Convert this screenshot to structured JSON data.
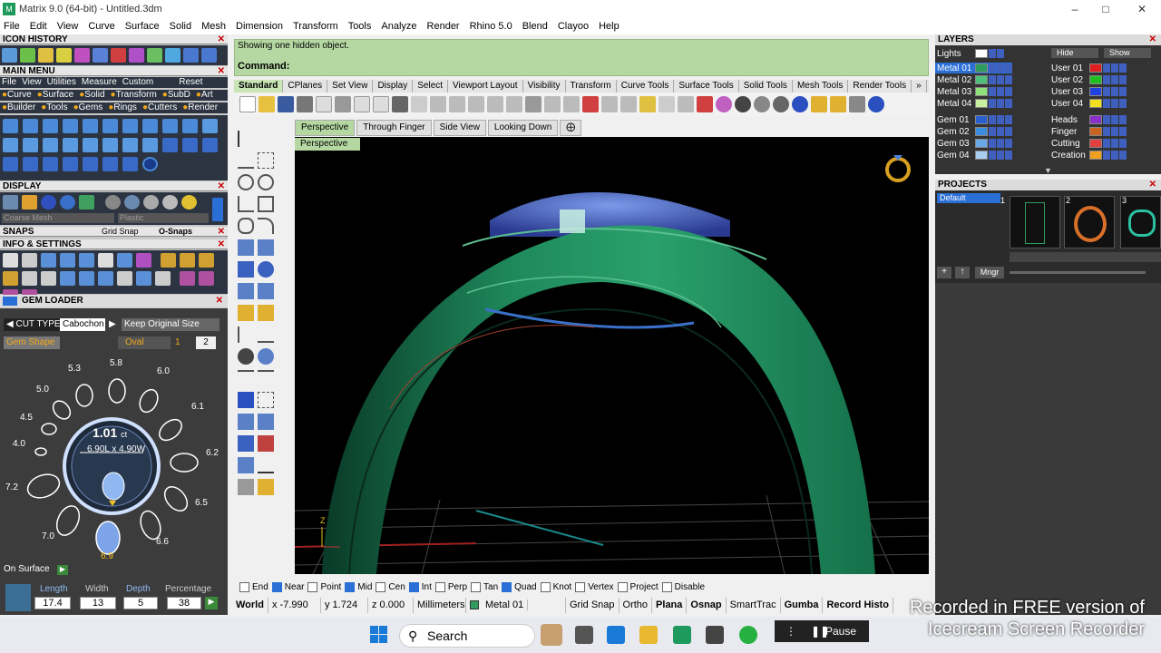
{
  "window": {
    "title": "Matrix 9.0 (64-bit) - Untitled.3dm"
  },
  "menu": [
    "File",
    "Edit",
    "View",
    "Curve",
    "Surface",
    "Solid",
    "Mesh",
    "Dimension",
    "Transform",
    "Tools",
    "Analyze",
    "Render",
    "Rhino 5.0",
    "Blend",
    "Clayoo",
    "Help"
  ],
  "left": {
    "icon_history": "ICON HISTORY",
    "main_menu": "MAIN MENU",
    "main_menu_row1": [
      "File",
      "View",
      "Utilities",
      "Measure",
      "Custom"
    ],
    "main_menu_reset": "Reset",
    "main_menu_row2": [
      "Curve",
      "Surface",
      "Solid",
      "Transform",
      "SubD",
      "Art"
    ],
    "main_menu_row3": [
      "Builder",
      "Tools",
      "Gems",
      "Rings",
      "Cutters",
      "Render"
    ],
    "display": "DISPLAY",
    "display_mesh": "Coarse Mesh",
    "display_material": "Plastic",
    "snaps": "SNAPS",
    "grid_snap": "Grid Snap",
    "osnaps": "O-Snaps",
    "info_settings": "INFO & SETTINGS",
    "gem_loader": "GEM LOADER",
    "cut_type_label": "CUT TYPE",
    "cut_type_value": "Cabochon",
    "keep_original": "Keep Original Size",
    "gem_shape_label": "Gem Shape",
    "gem_shape_value": "Oval",
    "gem_opt1": "1",
    "gem_opt2": "2",
    "sizes": [
      "5.8",
      "6.0",
      "6.1",
      "6.2",
      "6.5",
      "6.6",
      "6.9",
      "7.0",
      "7.2",
      "4.0",
      "4.5",
      "5.0",
      "5.3"
    ],
    "carat": "1.01",
    "carat_unit": "ct",
    "dims": "6.90L x 4.90W",
    "on_surface": "On Surface",
    "length_label": "Length",
    "width_label": "Width",
    "depth_label": "Depth",
    "percentage_label": "Percentage",
    "length": "17.4",
    "width": "13",
    "depth": "5",
    "percentage": "38"
  },
  "command": {
    "message": "Showing one hidden object.",
    "label": "Command:"
  },
  "tabs": [
    "Standard",
    "CPlanes",
    "Set View",
    "Display",
    "Select",
    "Viewport Layout",
    "Visibility",
    "Transform",
    "Curve Tools",
    "Surface Tools",
    "Solid Tools",
    "Mesh Tools",
    "Render Tools"
  ],
  "viewport_tabs": [
    "Perspective",
    "Through Finger",
    "Side View",
    "Looking Down"
  ],
  "viewport_name": "Perspective",
  "osnaps": [
    {
      "label": "End",
      "on": false
    },
    {
      "label": "Near",
      "on": true
    },
    {
      "label": "Point",
      "on": false
    },
    {
      "label": "Mid",
      "on": true
    },
    {
      "label": "Cen",
      "on": false
    },
    {
      "label": "Int",
      "on": true
    },
    {
      "label": "Perp",
      "on": false
    },
    {
      "label": "Tan",
      "on": false
    },
    {
      "label": "Quad",
      "on": true
    },
    {
      "label": "Knot",
      "on": false
    },
    {
      "label": "Vertex",
      "on": false
    },
    {
      "label": "Project",
      "on": false
    },
    {
      "label": "Disable",
      "on": false
    }
  ],
  "status": {
    "cplane": "World",
    "x": "x -7.990",
    "y": "y 1.724",
    "z": "z 0.000",
    "units": "Millimeters",
    "layer": "Metal 01",
    "items": [
      "Grid Snap",
      "Ortho",
      "Plana",
      "Osnap",
      "SmartTrac",
      "Gumba",
      "Record Histo"
    ]
  },
  "layers": {
    "title": "LAYERS",
    "lights": "Lights",
    "hide": "Hide",
    "show": "Show",
    "left": [
      {
        "name": "Metal 01",
        "color": "#2e9c5f"
      },
      {
        "name": "Metal 02",
        "color": "#4fc07a"
      },
      {
        "name": "Metal 03",
        "color": "#8fe07a"
      },
      {
        "name": "Metal 04",
        "color": "#c8f0a0"
      },
      {
        "name": "Gem 01",
        "color": "#2a5fd0"
      },
      {
        "name": "Gem 02",
        "color": "#3c8ce0"
      },
      {
        "name": "Gem 03",
        "color": "#6aa8e8"
      },
      {
        "name": "Gem 04",
        "color": "#a8cdf0"
      }
    ],
    "right": [
      {
        "name": "User 01",
        "color": "#e02020"
      },
      {
        "name": "User 02",
        "color": "#20c020"
      },
      {
        "name": "User 03",
        "color": "#2040e0"
      },
      {
        "name": "User 04",
        "color": "#f0e020"
      },
      {
        "name": "Heads",
        "color": "#8a30c8"
      },
      {
        "name": "Finger",
        "color": "#c86420"
      },
      {
        "name": "Cutting",
        "color": "#e04040"
      },
      {
        "name": "Creation",
        "color": "#f0a020"
      }
    ]
  },
  "projects": {
    "title": "PROJECTS",
    "default": "Default",
    "mngr": "Mngr",
    "thumbs": [
      "1",
      "2",
      "3"
    ]
  },
  "taskbar": {
    "search": "Search",
    "pause": "Pause"
  },
  "watermark": "Recorded in FREE version of Icecream Screen Recorder",
  "viewport_label": "Z"
}
